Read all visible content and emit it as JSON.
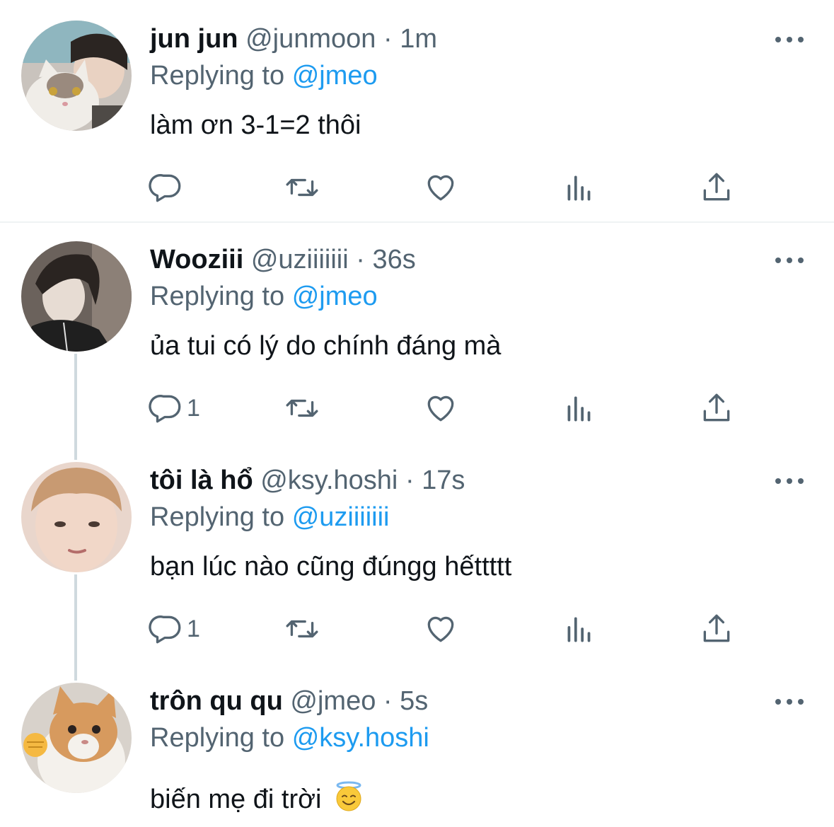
{
  "tweets": [
    {
      "name": "jun jun",
      "handle": "@junmoon",
      "dot": "·",
      "time": "1m",
      "replying_prefix": "Replying to",
      "replying_to": "@jmeo",
      "text": "làm ơn 3-1=2 thôi",
      "reply_count": ""
    },
    {
      "name": "Wooziii",
      "handle": "@uziiiiiii",
      "dot": "·",
      "time": "36s",
      "replying_prefix": "Replying to",
      "replying_to": "@jmeo",
      "text": "ủa tui có lý do chính đáng mà",
      "reply_count": "1"
    },
    {
      "name": "tôi là hổ",
      "handle": "@ksy.hoshi",
      "dot": "·",
      "time": "17s",
      "replying_prefix": "Replying to",
      "replying_to": "@uziiiiiii",
      "text": "bạn lúc nào cũng đúngg hếttttt",
      "reply_count": "1"
    },
    {
      "name": "trôn qu qu",
      "handle": "@jmeo",
      "dot": "·",
      "time": "5s",
      "replying_prefix": "Replying to",
      "replying_to": "@ksy.hoshi",
      "text": "biến mẹ đi trời",
      "emoji": "smiling-face-with-halo"
    }
  ],
  "icons": {
    "reply": "reply-icon",
    "retweet": "retweet-icon",
    "like": "heart-icon",
    "views": "views-icon",
    "share": "share-icon",
    "more": "more-icon"
  },
  "colors": {
    "text": "#0f1419",
    "secondary": "#536471",
    "link": "#1d9bf0",
    "thread_line": "#cfd9de"
  }
}
